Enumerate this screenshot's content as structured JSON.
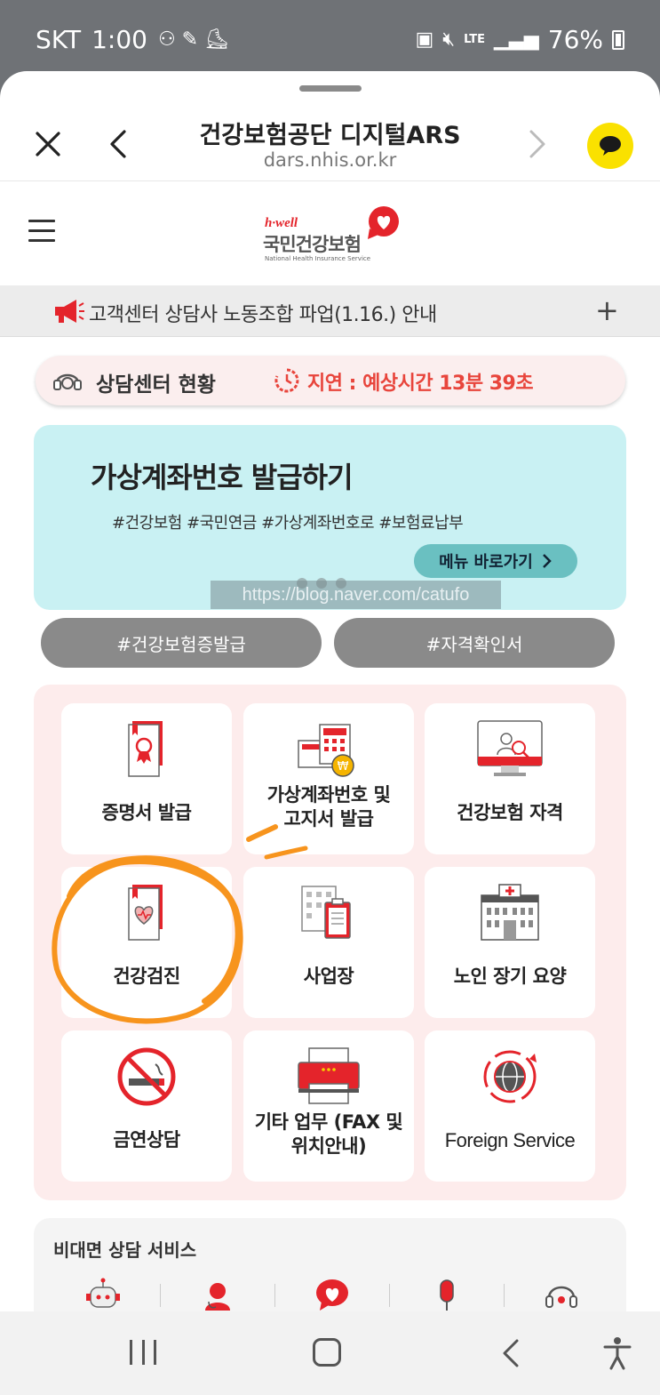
{
  "status_bar": {
    "carrier": "SKT",
    "time": "1:00",
    "network": "LTE",
    "battery": "76%"
  },
  "browser": {
    "title": "건강보험공단 디지털ARS",
    "url": "dars.nhis.or.kr"
  },
  "logo": {
    "brand": "h·well",
    "name_kr": "국민건강보험",
    "name_en": "National Health Insurance Service"
  },
  "notice": {
    "text": "고객센터 상담사 노동조합 파업(1.16.) 안내",
    "expand": "+"
  },
  "consult_status": {
    "label": "상담센터 현황",
    "status": "지연 : 예상시간 13분 39초"
  },
  "banner": {
    "title": "가상계좌번호 발급하기",
    "tags": "#건강보험 #국민연금 #가상계좌번호로 #보험료납부",
    "button": "메뉴 바로가기",
    "watermark": "https://blog.naver.com/catufo"
  },
  "quick_tags": [
    "#건강보험증발급",
    "#자격확인서"
  ],
  "menu": [
    {
      "label": "증명서 발급",
      "icon": "certificate-icon"
    },
    {
      "label": "가상계좌번호 및 고지서 발급",
      "label_line1": "가상계좌번호 및",
      "label_line2": "고지서 발급",
      "icon": "virtual-account-icon"
    },
    {
      "label": "건강보험 자격",
      "icon": "eligibility-icon"
    },
    {
      "label": "건강검진",
      "icon": "health-checkup-icon"
    },
    {
      "label": "사업장",
      "icon": "workplace-icon"
    },
    {
      "label": "노인 장기 요양",
      "icon": "hospital-icon"
    },
    {
      "label": "금연상담",
      "icon": "no-smoking-icon"
    },
    {
      "label": "기타 업무 (FAX 및 위치안내)",
      "label_line1": "기타 업무 (FAX 및",
      "label_line2": "위치안내)",
      "icon": "fax-icon"
    },
    {
      "label": "Foreign Service",
      "icon": "globe-icon"
    }
  ],
  "contactless": {
    "title": "비대면 상담 서비스",
    "icons": [
      "chatbot-icon",
      "consultant-icon",
      "heart-chat-icon",
      "microphone-icon",
      "headset-icon"
    ]
  },
  "colors": {
    "accent_red": "#e4242b",
    "delay_red": "#e8453c",
    "banner_bg": "#c9f1f3",
    "panel_bg": "#fdecec",
    "annotation_orange": "#f7941d",
    "kakao_yellow": "#fae100"
  }
}
